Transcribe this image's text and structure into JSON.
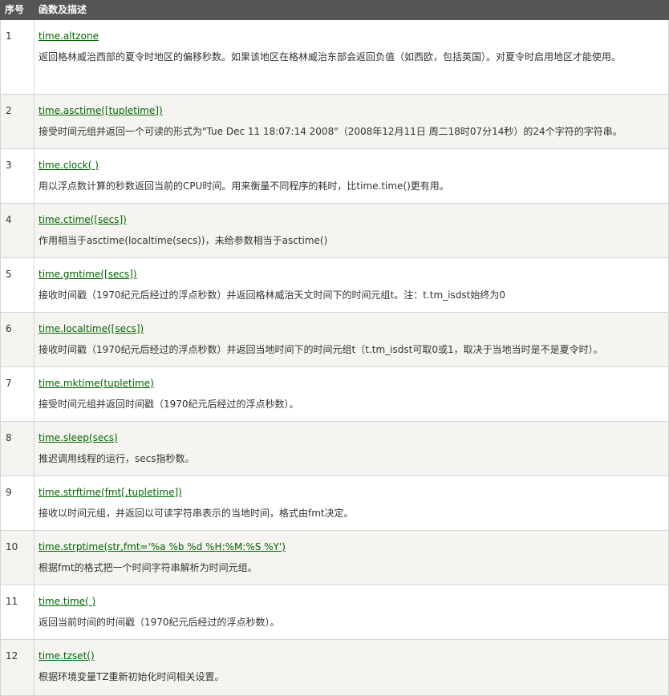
{
  "header": {
    "num_label": "序号",
    "desc_label": "函数及描述"
  },
  "rows": [
    {
      "num": "1",
      "func": "time.altzone",
      "desc": "返回格林威治西部的夏令时地区的偏移秒数。如果该地区在格林威治东部会返回负值（如西欧，包括英国）。对夏令时启用地区才能使用。"
    },
    {
      "num": "2",
      "func": "time.asctime([tupletime])",
      "desc": "接受时间元组并返回一个可读的形式为\"Tue Dec 11 18:07:14 2008\"（2008年12月11日 周二18时07分14秒）的24个字符的字符串。"
    },
    {
      "num": "3",
      "func": "time.clock( )",
      "desc": "用以浮点数计算的秒数返回当前的CPU时间。用来衡量不同程序的耗时，比time.time()更有用。"
    },
    {
      "num": "4",
      "func": "time.ctime([secs])",
      "desc": "作用相当于asctime(localtime(secs))，未给参数相当于asctime()"
    },
    {
      "num": "5",
      "func": "time.gmtime([secs])",
      "desc": "接收时间戳（1970纪元后经过的浮点秒数）并返回格林威治天文时间下的时间元组t。注：t.tm_isdst始终为0"
    },
    {
      "num": "6",
      "func": "time.localtime([secs])",
      "desc": "接收时间戳（1970纪元后经过的浮点秒数）并返回当地时间下的时间元组t（t.tm_isdst可取0或1，取决于当地当时是不是夏令时）。"
    },
    {
      "num": "7",
      "func": "time.mktime(tupletime)",
      "desc": "接受时间元组并返回时间戳（1970纪元后经过的浮点秒数）。"
    },
    {
      "num": "8",
      "func": "time.sleep(secs)",
      "desc": "推迟调用线程的运行，secs指秒数。"
    },
    {
      "num": "9",
      "func": "time.strftime(fmt[,tupletime])",
      "desc": "接收以时间元组，并返回以可读字符串表示的当地时间，格式由fmt决定。"
    },
    {
      "num": "10",
      "func": "time.strptime(str,fmt='%a %b %d %H:%M:%S %Y')",
      "desc": "根据fmt的格式把一个时间字符串解析为时间元组。"
    },
    {
      "num": "11",
      "func": "time.time( )",
      "desc": "返回当前时间的时间戳（1970纪元后经过的浮点秒数）。"
    },
    {
      "num": "12",
      "func": "time.tzset()",
      "desc": "根据环境变量TZ重新初始化时间相关设置。"
    }
  ],
  "colors": {
    "header_bg": "#555555",
    "link": "#006600",
    "row_alt_bg": "#f6f4f0",
    "border": "#d4d4d4"
  }
}
